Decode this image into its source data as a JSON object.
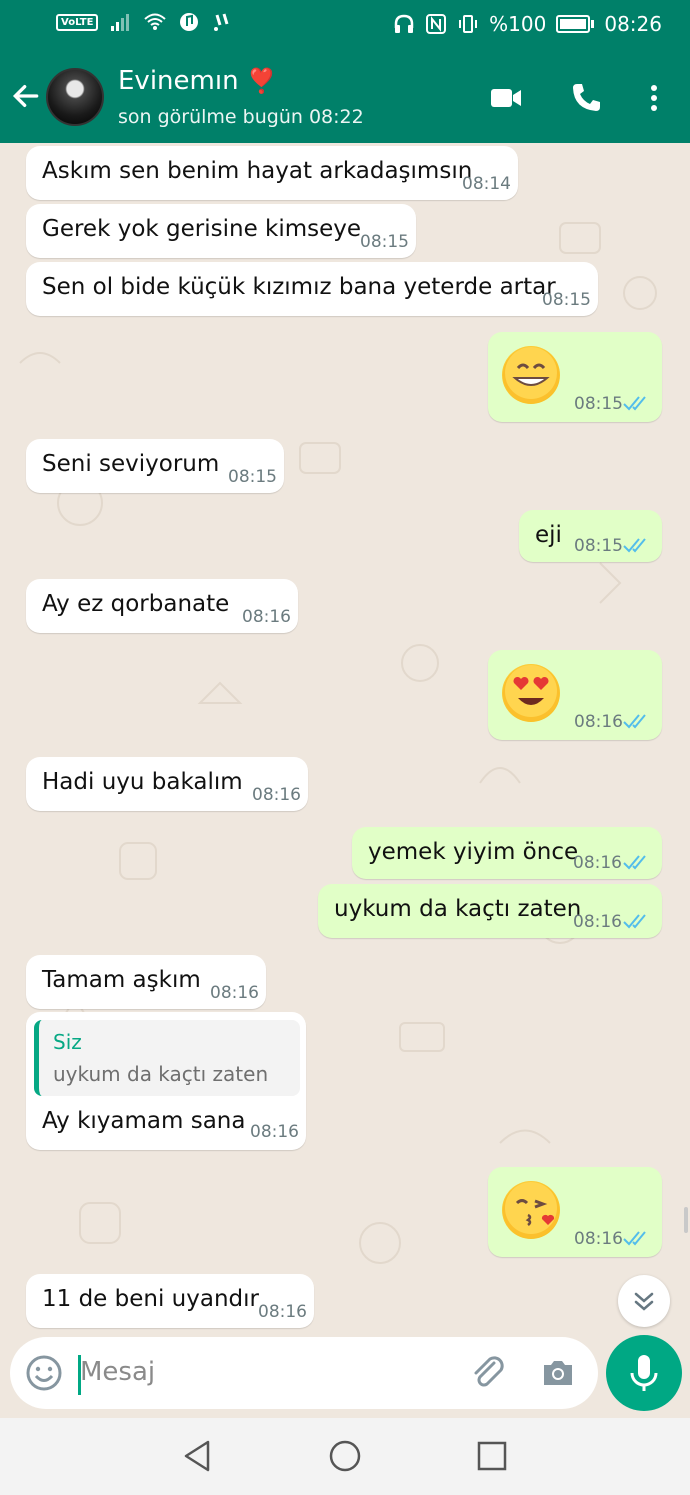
{
  "status_bar": {
    "volte": "VoLTE",
    "battery": "%100",
    "time": "08:26"
  },
  "header": {
    "name": "Evinemın",
    "name_emoji": "❣️",
    "status": "son görülme bugün 08:22"
  },
  "messages": [
    {
      "dir": "in",
      "text": "Askım sen benim hayat arkadaşımsın",
      "time": "08:14"
    },
    {
      "dir": "in",
      "text": "Gerek yok gerisine kimseye",
      "time": "08:15"
    },
    {
      "dir": "in",
      "text": "Sen ol bide küçük kızımız bana yeterde artar",
      "time": "08:15"
    },
    {
      "dir": "out",
      "emoji": "😁",
      "time": "08:15"
    },
    {
      "dir": "in",
      "text": "Seni seviyorum",
      "time": "08:15"
    },
    {
      "dir": "out",
      "text": "eji",
      "time": "08:15"
    },
    {
      "dir": "in",
      "text": "Ay ez qorbanate",
      "time": "08:16"
    },
    {
      "dir": "out",
      "emoji": "😍",
      "time": "08:16"
    },
    {
      "dir": "in",
      "text": "Hadi uyu bakalım",
      "time": "08:16"
    },
    {
      "dir": "out",
      "text": "yemek yiyim önce",
      "time": "08:16"
    },
    {
      "dir": "out",
      "text": "uykum da kaçtı zaten",
      "time": "08:16"
    },
    {
      "dir": "in",
      "text": "Tamam aşkım",
      "time": "08:16"
    },
    {
      "dir": "in",
      "reply_to": "Siz",
      "reply_text": "uykum da kaçtı zaten",
      "text": "Ay kıyamam sana",
      "time": "08:16"
    },
    {
      "dir": "out",
      "emoji": "😘",
      "time": "08:16"
    },
    {
      "dir": "in",
      "text": "11 de beni uyandır",
      "time": "08:16"
    }
  ],
  "input": {
    "placeholder": "Mesaj"
  },
  "colors": {
    "header": "#008069",
    "accent": "#00a884",
    "outgoing_bubble": "#e1ffc7",
    "read_ticks": "#53bdeb"
  },
  "icons": [
    "back-arrow-icon",
    "video-call-icon",
    "phone-icon",
    "more-vert-icon",
    "emoji-icon",
    "attach-icon",
    "camera-icon",
    "mic-icon",
    "chevron-double-down-icon",
    "nav-back-icon",
    "nav-home-icon",
    "nav-recents-icon"
  ]
}
